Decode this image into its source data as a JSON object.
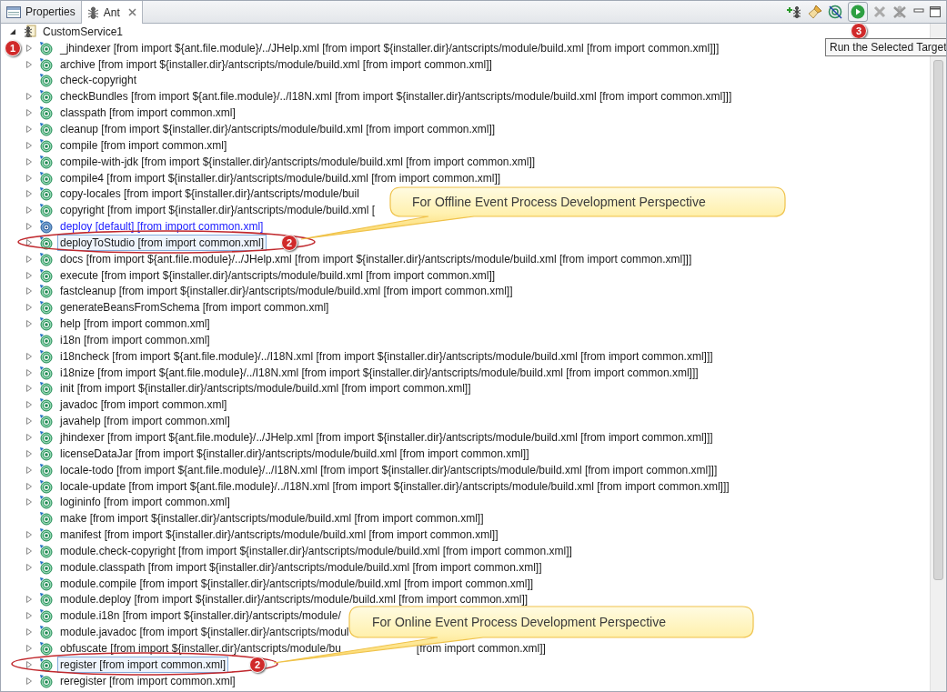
{
  "tabs": [
    {
      "label": "Properties",
      "selected": false,
      "closable": false
    },
    {
      "label": "Ant",
      "selected": true,
      "closable": true
    }
  ],
  "toolbar": {
    "tooltip": "Run the Selected Target"
  },
  "tree": {
    "label": "CustomService1",
    "expanded": true,
    "children": [
      {
        "label": "_jhindexer [from import ${ant.file.module}/../JHelp.xml [from import ${installer.dir}/antscripts/module/build.xml [from import common.xml]]]",
        "has_children": true,
        "default": false,
        "selected": false
      },
      {
        "label": "archive [from import ${installer.dir}/antscripts/module/build.xml [from import common.xml]]",
        "has_children": true,
        "default": false,
        "selected": false
      },
      {
        "label": "check-copyright",
        "has_children": false,
        "default": false,
        "selected": false
      },
      {
        "label": "checkBundles [from import ${ant.file.module}/../I18N.xml [from import ${installer.dir}/antscripts/module/build.xml [from import common.xml]]]",
        "has_children": true,
        "default": false,
        "selected": false
      },
      {
        "label": "classpath [from import common.xml]",
        "has_children": true,
        "default": false,
        "selected": false
      },
      {
        "label": "cleanup [from import ${installer.dir}/antscripts/module/build.xml [from import common.xml]]",
        "has_children": true,
        "default": false,
        "selected": false
      },
      {
        "label": "compile [from import common.xml]",
        "has_children": true,
        "default": false,
        "selected": false
      },
      {
        "label": "compile-with-jdk [from import ${installer.dir}/antscripts/module/build.xml [from import common.xml]]",
        "has_children": true,
        "default": false,
        "selected": false
      },
      {
        "label": "compile4 [from import ${installer.dir}/antscripts/module/build.xml [from import common.xml]]",
        "has_children": true,
        "default": false,
        "selected": false
      },
      {
        "label": "copy-locales [from import ${installer.dir}/antscripts/module/buil",
        "has_children": true,
        "default": false,
        "selected": false
      },
      {
        "label": "copyright [from import ${installer.dir}/antscripts/module/build.xml [",
        "has_children": true,
        "default": false,
        "selected": false
      },
      {
        "label": "deploy [default] [from import common.xml]",
        "has_children": true,
        "default": true,
        "selected": false
      },
      {
        "label": "deployToStudio [from import common.xml]",
        "has_children": true,
        "default": false,
        "selected": true
      },
      {
        "label": "docs [from import ${ant.file.module}/../JHelp.xml [from import ${installer.dir}/antscripts/module/build.xml [from import common.xml]]]",
        "has_children": true,
        "default": false,
        "selected": false
      },
      {
        "label": "execute [from import ${installer.dir}/antscripts/module/build.xml [from import common.xml]]",
        "has_children": true,
        "default": false,
        "selected": false
      },
      {
        "label": "fastcleanup [from import ${installer.dir}/antscripts/module/build.xml [from import common.xml]]",
        "has_children": true,
        "default": false,
        "selected": false
      },
      {
        "label": "generateBeansFromSchema [from import common.xml]",
        "has_children": true,
        "default": false,
        "selected": false
      },
      {
        "label": "help [from import common.xml]",
        "has_children": true,
        "default": false,
        "selected": false
      },
      {
        "label": "i18n [from import common.xml]",
        "has_children": false,
        "default": false,
        "selected": false
      },
      {
        "label": "i18ncheck [from import ${ant.file.module}/../I18N.xml [from import ${installer.dir}/antscripts/module/build.xml [from import common.xml]]]",
        "has_children": true,
        "default": false,
        "selected": false
      },
      {
        "label": "i18nize [from import ${ant.file.module}/../I18N.xml [from import ${installer.dir}/antscripts/module/build.xml [from import common.xml]]]",
        "has_children": true,
        "default": false,
        "selected": false
      },
      {
        "label": "init [from import ${installer.dir}/antscripts/module/build.xml [from import common.xml]]",
        "has_children": true,
        "default": false,
        "selected": false
      },
      {
        "label": "javadoc [from import common.xml]",
        "has_children": true,
        "default": false,
        "selected": false
      },
      {
        "label": "javahelp [from import common.xml]",
        "has_children": true,
        "default": false,
        "selected": false
      },
      {
        "label": "jhindexer [from import ${ant.file.module}/../JHelp.xml [from import ${installer.dir}/antscripts/module/build.xml [from import common.xml]]]",
        "has_children": true,
        "default": false,
        "selected": false
      },
      {
        "label": "licenseDataJar [from import ${installer.dir}/antscripts/module/build.xml [from import common.xml]]",
        "has_children": true,
        "default": false,
        "selected": false
      },
      {
        "label": "locale-todo [from import ${ant.file.module}/../I18N.xml [from import ${installer.dir}/antscripts/module/build.xml [from import common.xml]]]",
        "has_children": true,
        "default": false,
        "selected": false
      },
      {
        "label": "locale-update [from import ${ant.file.module}/../I18N.xml [from import ${installer.dir}/antscripts/module/build.xml [from import common.xml]]]",
        "has_children": true,
        "default": false,
        "selected": false
      },
      {
        "label": "logininfo [from import common.xml]",
        "has_children": true,
        "default": false,
        "selected": false
      },
      {
        "label": "make [from import ${installer.dir}/antscripts/module/build.xml [from import common.xml]]",
        "has_children": false,
        "default": false,
        "selected": false
      },
      {
        "label": "manifest [from import ${installer.dir}/antscripts/module/build.xml [from import common.xml]]",
        "has_children": true,
        "default": false,
        "selected": false
      },
      {
        "label": "module.check-copyright [from import ${installer.dir}/antscripts/module/build.xml [from import common.xml]]",
        "has_children": true,
        "default": false,
        "selected": false
      },
      {
        "label": "module.classpath [from import ${installer.dir}/antscripts/module/build.xml [from import common.xml]]",
        "has_children": true,
        "default": false,
        "selected": false
      },
      {
        "label": "module.compile [from import ${installer.dir}/antscripts/module/build.xml [from import common.xml]]",
        "has_children": false,
        "default": false,
        "selected": false
      },
      {
        "label": "module.deploy [from import ${installer.dir}/antscripts/module/build.xml [from import common.xml]]",
        "has_children": true,
        "default": false,
        "selected": false
      },
      {
        "label": "module.i18n [from import ${installer.dir}/antscripts/module/",
        "has_children": true,
        "default": false,
        "selected": false
      },
      {
        "label": "module.javadoc [from import ${installer.dir}/antscripts/modul",
        "has_children": true,
        "default": false,
        "selected": false
      },
      {
        "label": "obfuscate [from import ${installer.dir}/antscripts/module/bu",
        "continuation": "[from import common.xml]]",
        "has_children": true,
        "default": false,
        "selected": false
      },
      {
        "label": "register [from import common.xml]",
        "has_children": true,
        "default": false,
        "selected": true
      },
      {
        "label": "reregister [from import common.xml]",
        "has_children": true,
        "default": false,
        "selected": false
      }
    ]
  },
  "annotations": {
    "badges": [
      "1",
      "2",
      "2",
      "3"
    ],
    "callouts": [
      "For Offline Event Process Development Perspective",
      "For Online Event Process Development Perspective"
    ]
  }
}
